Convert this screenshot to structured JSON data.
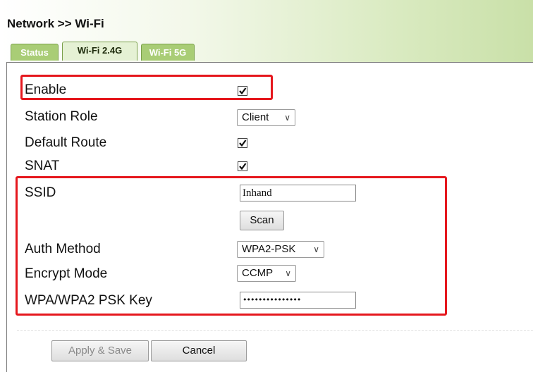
{
  "page": {
    "title": "Network >> Wi-Fi"
  },
  "tabs": [
    {
      "label": "Status",
      "active": false
    },
    {
      "label": "Wi-Fi 2.4G",
      "active": true
    },
    {
      "label": "Wi-Fi 5G",
      "active": false
    }
  ],
  "form": {
    "enable": {
      "label": "Enable",
      "checked": true
    },
    "station_role": {
      "label": "Station Role",
      "value": "Client"
    },
    "default_route": {
      "label": "Default Route",
      "checked": true
    },
    "snat": {
      "label": "SNAT",
      "checked": true
    },
    "ssid": {
      "label": "SSID",
      "value": "Inhand"
    },
    "scan_button": "Scan",
    "auth_method": {
      "label": "Auth Method",
      "value": "WPA2-PSK"
    },
    "encrypt_mode": {
      "label": "Encrypt Mode",
      "value": "CCMP"
    },
    "psk_key": {
      "label": "WPA/WPA2 PSK Key",
      "masked_value": "•••••••••••••••"
    }
  },
  "actions": {
    "apply_label": "Apply & Save",
    "cancel_label": "Cancel"
  },
  "colors": {
    "highlight": "#e5171d",
    "tab_active_bg": "#e5f1d4",
    "tab_inactive_bg": "#a9cd76"
  }
}
